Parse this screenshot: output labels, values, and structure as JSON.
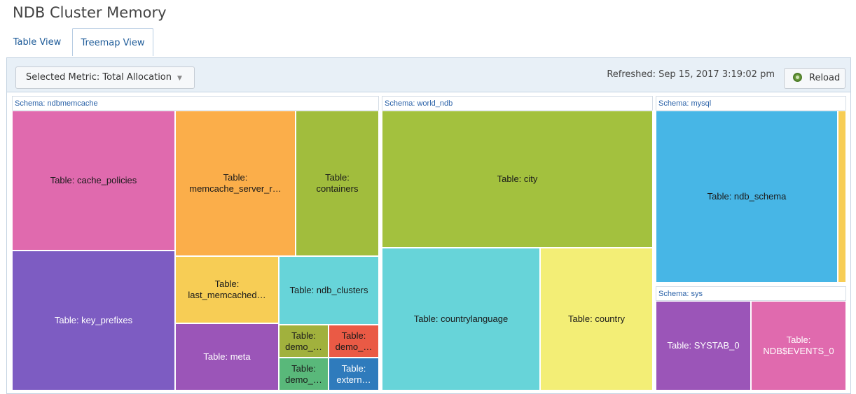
{
  "page": {
    "title": "NDB Cluster Memory"
  },
  "tabs": [
    {
      "label": "Table View",
      "active": false
    },
    {
      "label": "Treemap View",
      "active": true
    }
  ],
  "toolbar": {
    "metric_label": "Selected Metric: Total Allocation",
    "refreshed": "Refreshed: Sep 15, 2017 3:19:02 pm",
    "reload_label": "Reload"
  },
  "treemap": {
    "schemas": {
      "ndbmemcache": "Schema: ndbmemcache",
      "world_ndb": "Schema: world_ndb",
      "mysql": "Schema: mysql",
      "sys": "Schema: sys"
    },
    "tables": {
      "cache_policies": "Table: cache_policies",
      "key_prefixes": "Table: key_prefixes",
      "memcache_server_roles_l1": "Table:",
      "memcache_server_roles_l2": "memcache_server_r…",
      "containers_l1": "Table:",
      "containers_l2": "containers",
      "last_memcached_l1": "Table:",
      "last_memcached_l2": "last_memcached…",
      "ndb_clusters": "Table: ndb_clusters",
      "meta": "Table: meta",
      "demo1_l1": "Table:",
      "demo1_l2": "demo_…",
      "demo2_l1": "Table:",
      "demo2_l2": "demo_…",
      "demo3_l1": "Table:",
      "demo3_l2": "demo_…",
      "extern_l1": "Table:",
      "extern_l2": "extern…",
      "city": "Table: city",
      "countrylanguage": "Table: countrylanguage",
      "country": "Table: country",
      "ndb_schema": "Table: ndb_schema",
      "systab_0": "Table: SYSTAB_0",
      "ndb_events_l1": "Table:",
      "ndb_events_l2": "NDB$EVENTS_0"
    },
    "colors": {
      "pink": "#e06aae",
      "purple": "#7d5cc2",
      "orange": "#fbae4a",
      "olive": "#a1bd3d",
      "yellow": "#f7cd55",
      "cyan": "#67d4d9",
      "violet": "#9b55b8",
      "olive_dark": "#a1b13d",
      "red": "#ea5a45",
      "green": "#59b87a",
      "blue": "#2f7bbc",
      "lime": "#a3c13e",
      "pale_yellow": "#f3ee76",
      "sky": "#47b6e6"
    }
  }
}
